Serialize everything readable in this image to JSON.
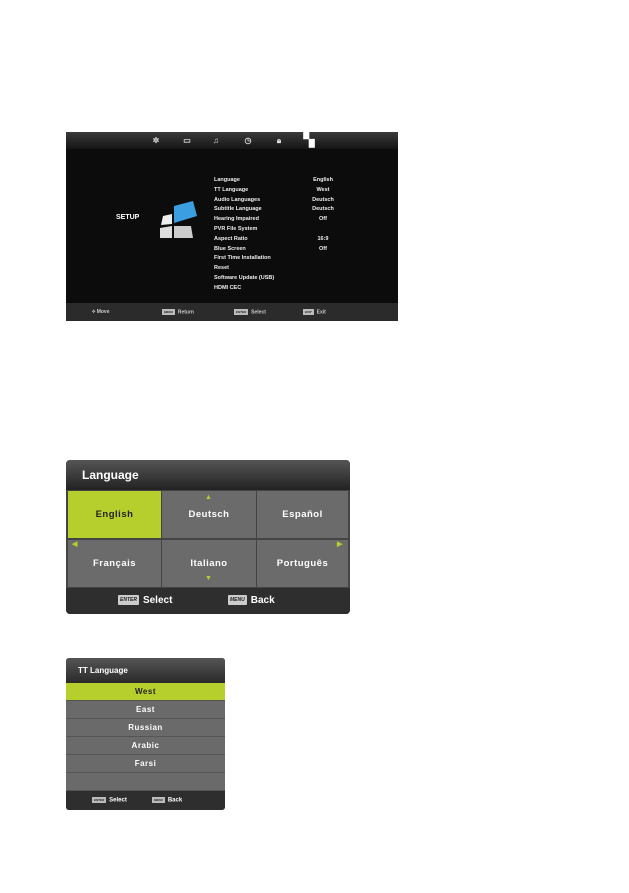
{
  "setup_menu": {
    "tab_icons": [
      "picture-icon",
      "screen-icon",
      "sound-icon",
      "time-icon",
      "lock-icon",
      "setup-icon"
    ],
    "title": "SETUP",
    "items": [
      {
        "label": "Language",
        "value": "English"
      },
      {
        "label": "TT Language",
        "value": "West"
      },
      {
        "label": "Audio Languages",
        "value": "Deutsch"
      },
      {
        "label": "Subtitle Language",
        "value": "Deutsch"
      },
      {
        "label": "Hearing Impaired",
        "value": "Off"
      },
      {
        "label": "PVR File System",
        "value": ""
      },
      {
        "label": "Aspect Ratio",
        "value": "16:9"
      },
      {
        "label": "Blue Screen",
        "value": "Off"
      },
      {
        "label": "First Time Installation",
        "value": ""
      },
      {
        "label": "Reset",
        "value": ""
      },
      {
        "label": "Software Update (USB)",
        "value": ""
      },
      {
        "label": "HDMI CEC",
        "value": ""
      }
    ],
    "footer": [
      {
        "key": "",
        "label": "Move"
      },
      {
        "key": "MENU",
        "label": "Return"
      },
      {
        "key": "ENTER",
        "label": "Select"
      },
      {
        "key": "EXIT",
        "label": "Exit"
      }
    ]
  },
  "language_menu": {
    "title": "Language",
    "options": [
      "English",
      "Deutsch",
      "Español",
      "Français",
      "Italiano",
      "Português"
    ],
    "selected": "English",
    "footer": [
      {
        "key": "ENTER",
        "label": "Select"
      },
      {
        "key": "MENU",
        "label": "Back"
      }
    ]
  },
  "tt_language_menu": {
    "title": "TT Language",
    "options": [
      "West",
      "East",
      "Russian",
      "Arabic",
      "Farsi"
    ],
    "selected": "West",
    "footer": [
      {
        "key": "ENTER",
        "label": "Select"
      },
      {
        "key": "MENU",
        "label": "Back"
      }
    ]
  },
  "colors": {
    "highlight": "#b6cf2c",
    "accent_blue": "#3a9ee0"
  }
}
